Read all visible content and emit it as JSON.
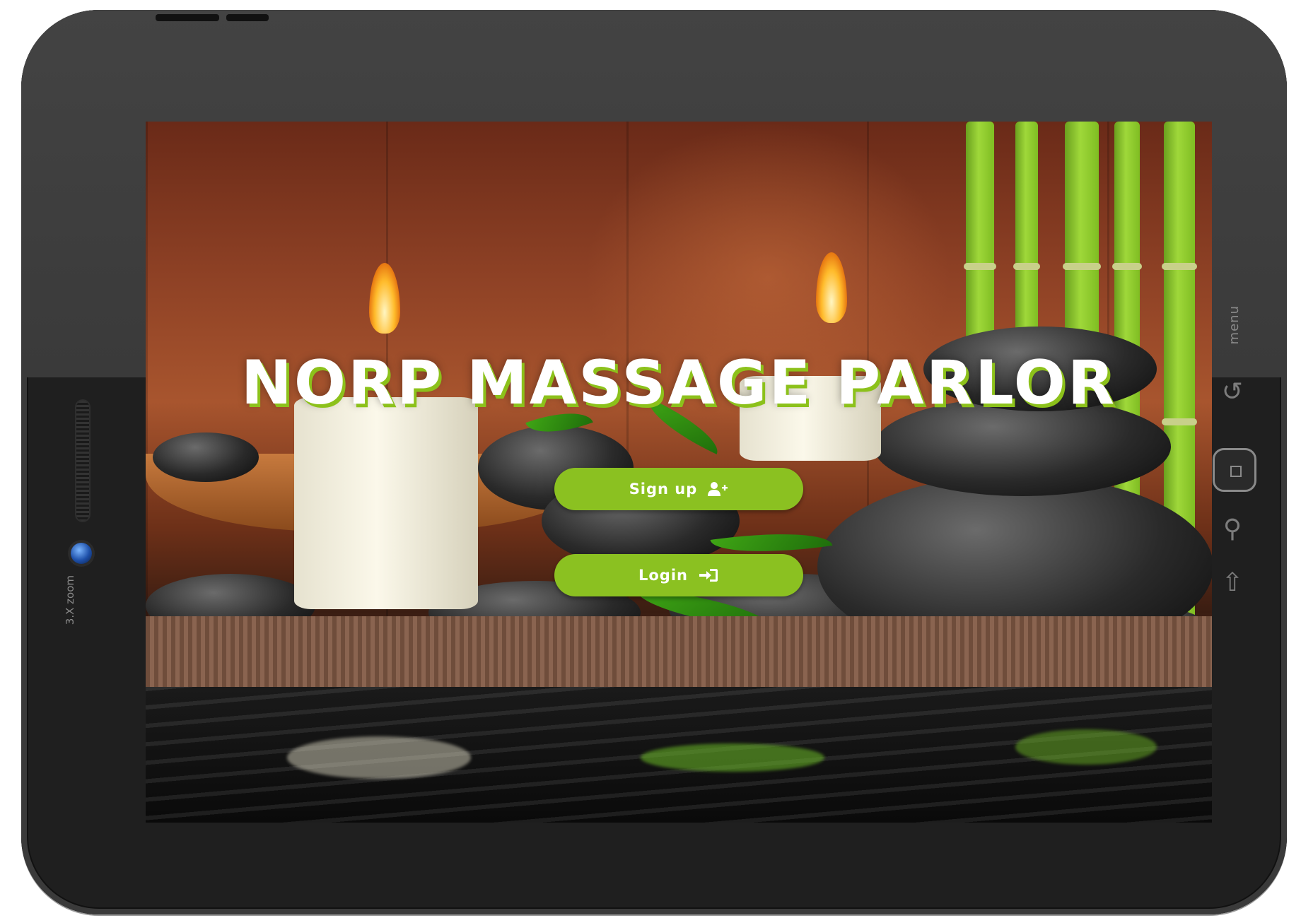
{
  "device": {
    "side_label": "menu",
    "zoom_label": "3.X zoom",
    "accent_color": "#8bc121"
  },
  "screen": {
    "title": "NORP MASSAGE PARLOR",
    "buttons": {
      "signup_label": "Sign up",
      "signup_icon": "user-plus-icon",
      "login_label": "Login",
      "login_icon": "sign-in-icon"
    }
  }
}
